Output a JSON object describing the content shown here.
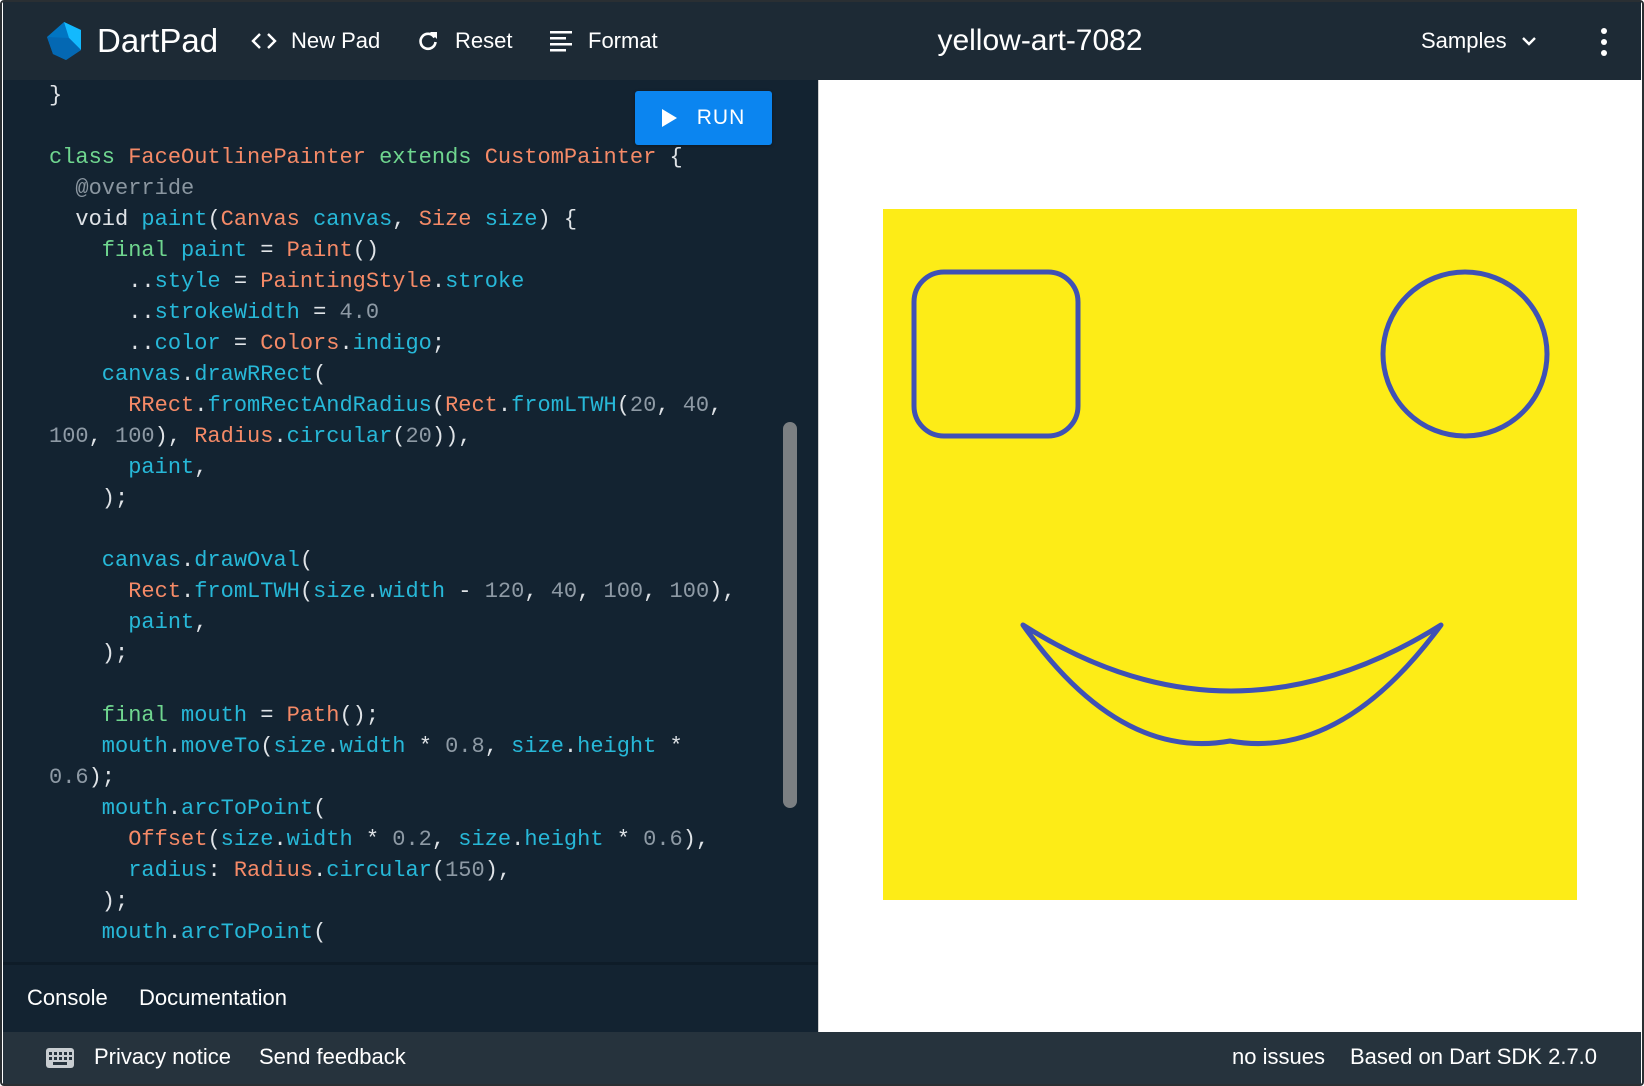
{
  "header": {
    "app_title": "DartPad",
    "new_pad_label": "New Pad",
    "reset_label": "Reset",
    "format_label": "Format",
    "pad_name": "yellow-art-7082",
    "samples_label": "Samples"
  },
  "editor": {
    "run_label": "RUN",
    "code_lines": [
      [
        [
          "pl",
          "}"
        ]
      ],
      [],
      [
        [
          "kw",
          "class "
        ],
        [
          "ty",
          "FaceOutlinePainter "
        ],
        [
          "kw",
          "extends "
        ],
        [
          "ty",
          "CustomPainter "
        ],
        [
          "pl",
          "{"
        ]
      ],
      [
        [
          "ann",
          "  @override"
        ]
      ],
      [
        [
          "pl",
          "  void "
        ],
        [
          "id",
          "paint"
        ],
        [
          "pl",
          "("
        ],
        [
          "ty",
          "Canvas "
        ],
        [
          "id",
          "canvas"
        ],
        [
          "pl",
          ", "
        ],
        [
          "ty",
          "Size "
        ],
        [
          "id",
          "size"
        ],
        [
          "pl",
          ") {"
        ]
      ],
      [
        [
          "kw",
          "    final "
        ],
        [
          "id",
          "paint "
        ],
        [
          "pl",
          "= "
        ],
        [
          "ty",
          "Paint"
        ],
        [
          "pl",
          "()"
        ]
      ],
      [
        [
          "pl",
          "      .."
        ],
        [
          "id",
          "style "
        ],
        [
          "pl",
          "= "
        ],
        [
          "ty",
          "PaintingStyle"
        ],
        [
          "pl",
          "."
        ],
        [
          "id",
          "stroke"
        ]
      ],
      [
        [
          "pl",
          "      .."
        ],
        [
          "id",
          "strokeWidth "
        ],
        [
          "pl",
          "= "
        ],
        [
          "num",
          "4.0"
        ]
      ],
      [
        [
          "pl",
          "      .."
        ],
        [
          "id",
          "color "
        ],
        [
          "pl",
          "= "
        ],
        [
          "ty",
          "Colors"
        ],
        [
          "pl",
          "."
        ],
        [
          "id",
          "indigo"
        ],
        [
          "pl",
          ";"
        ]
      ],
      [
        [
          "id",
          "    canvas"
        ],
        [
          "pl",
          "."
        ],
        [
          "id",
          "drawRRect"
        ],
        [
          "pl",
          "("
        ]
      ],
      [
        [
          "ty",
          "      RRect"
        ],
        [
          "pl",
          "."
        ],
        [
          "id",
          "fromRectAndRadius"
        ],
        [
          "pl",
          "("
        ],
        [
          "ty",
          "Rect"
        ],
        [
          "pl",
          "."
        ],
        [
          "id",
          "fromLTWH"
        ],
        [
          "pl",
          "("
        ],
        [
          "num",
          "20"
        ],
        [
          "pl",
          ", "
        ],
        [
          "num",
          "40"
        ],
        [
          "pl",
          ","
        ]
      ],
      [
        [
          "num",
          "100"
        ],
        [
          "pl",
          ", "
        ],
        [
          "num",
          "100"
        ],
        [
          "pl",
          "), "
        ],
        [
          "ty",
          "Radius"
        ],
        [
          "pl",
          "."
        ],
        [
          "id",
          "circular"
        ],
        [
          "pl",
          "("
        ],
        [
          "num",
          "20"
        ],
        [
          "pl",
          ")),"
        ]
      ],
      [
        [
          "id",
          "      paint"
        ],
        [
          "pl",
          ","
        ]
      ],
      [
        [
          "pl",
          "    );"
        ]
      ],
      [],
      [
        [
          "id",
          "    canvas"
        ],
        [
          "pl",
          "."
        ],
        [
          "id",
          "drawOval"
        ],
        [
          "pl",
          "("
        ]
      ],
      [
        [
          "ty",
          "      Rect"
        ],
        [
          "pl",
          "."
        ],
        [
          "id",
          "fromLTWH"
        ],
        [
          "pl",
          "("
        ],
        [
          "id",
          "size"
        ],
        [
          "pl",
          "."
        ],
        [
          "id",
          "width "
        ],
        [
          "pl",
          "- "
        ],
        [
          "num",
          "120"
        ],
        [
          "pl",
          ", "
        ],
        [
          "num",
          "40"
        ],
        [
          "pl",
          ", "
        ],
        [
          "num",
          "100"
        ],
        [
          "pl",
          ", "
        ],
        [
          "num",
          "100"
        ],
        [
          "pl",
          "),"
        ]
      ],
      [
        [
          "id",
          "      paint"
        ],
        [
          "pl",
          ","
        ]
      ],
      [
        [
          "pl",
          "    );"
        ]
      ],
      [],
      [
        [
          "kw",
          "    final "
        ],
        [
          "id",
          "mouth "
        ],
        [
          "pl",
          "= "
        ],
        [
          "ty",
          "Path"
        ],
        [
          "pl",
          "();"
        ]
      ],
      [
        [
          "id",
          "    mouth"
        ],
        [
          "pl",
          "."
        ],
        [
          "id",
          "moveTo"
        ],
        [
          "pl",
          "("
        ],
        [
          "id",
          "size"
        ],
        [
          "pl",
          "."
        ],
        [
          "id",
          "width "
        ],
        [
          "pl",
          "* "
        ],
        [
          "num",
          "0.8"
        ],
        [
          "pl",
          ", "
        ],
        [
          "id",
          "size"
        ],
        [
          "pl",
          "."
        ],
        [
          "id",
          "height "
        ],
        [
          "pl",
          "*"
        ]
      ],
      [
        [
          "num",
          "0.6"
        ],
        [
          "pl",
          ");"
        ]
      ],
      [
        [
          "id",
          "    mouth"
        ],
        [
          "pl",
          "."
        ],
        [
          "id",
          "arcToPoint"
        ],
        [
          "pl",
          "("
        ]
      ],
      [
        [
          "ty",
          "      Offset"
        ],
        [
          "pl",
          "("
        ],
        [
          "id",
          "size"
        ],
        [
          "pl",
          "."
        ],
        [
          "id",
          "width "
        ],
        [
          "pl",
          "* "
        ],
        [
          "num",
          "0.2"
        ],
        [
          "pl",
          ", "
        ],
        [
          "id",
          "size"
        ],
        [
          "pl",
          "."
        ],
        [
          "id",
          "height "
        ],
        [
          "pl",
          "* "
        ],
        [
          "num",
          "0.6"
        ],
        [
          "pl",
          "),"
        ]
      ],
      [
        [
          "id",
          "      radius"
        ],
        [
          "pl",
          ": "
        ],
        [
          "ty",
          "Radius"
        ],
        [
          "pl",
          "."
        ],
        [
          "id",
          "circular"
        ],
        [
          "pl",
          "("
        ],
        [
          "num",
          "150"
        ],
        [
          "pl",
          "),"
        ]
      ],
      [
        [
          "pl",
          "    );"
        ]
      ],
      [
        [
          "id",
          "    mouth"
        ],
        [
          "pl",
          "."
        ],
        [
          "id",
          "arcToPoint"
        ],
        [
          "pl",
          "("
        ]
      ]
    ]
  },
  "tabs": {
    "console_label": "Console",
    "documentation_label": "Documentation"
  },
  "output": {
    "background_color": "#fdec17",
    "stroke_color": "#3f51b5"
  },
  "status": {
    "keyboard_icon": "keyboard-icon",
    "privacy_label": "Privacy notice",
    "feedback_label": "Send feedback",
    "issues_label": "no issues",
    "sdk_label": "Based on Dart SDK 2.7.0"
  },
  "colors": {
    "header_bg": "#1d2a35",
    "editor_bg": "#132331",
    "run_button": "#0b85f0",
    "keyword": "#6fd68f",
    "type": "#f58a67",
    "identifier": "#27b8d8",
    "number": "#8e9aa5"
  }
}
